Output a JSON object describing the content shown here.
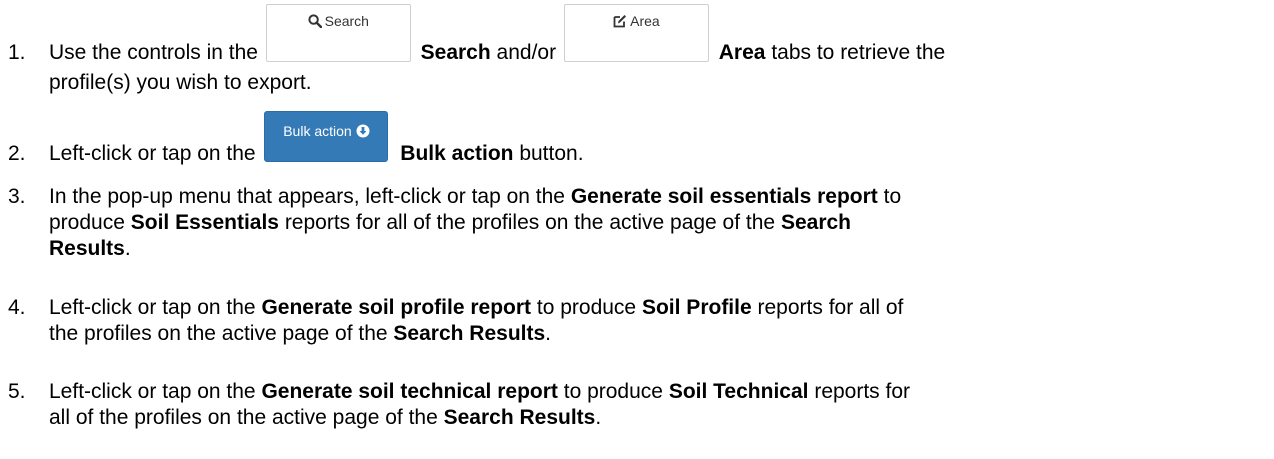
{
  "steps": [
    {
      "number": "1.",
      "text_a": "Use the controls in the",
      "search_tab_label": "Search",
      "search_bold": "Search",
      "text_b": "and/or",
      "area_tab_label": "Area",
      "area_bold": "Area",
      "text_c": "tabs to retrieve the",
      "text_d": "profile(s) you wish to export."
    },
    {
      "number": "2.",
      "text_a": "Left-click or tap on the",
      "button_label": "Bulk action",
      "bold": "Bulk action",
      "text_b": "button."
    },
    {
      "number": "3.",
      "text_a": "In the pop-up menu that appears, left-click or tap on the",
      "bold_a": "Generate soil essentials report",
      "text_b": "to",
      "text_c": "produce",
      "bold_b": "Soil Essentials",
      "text_d": "reports for all of the profiles on the active page of the",
      "bold_c": "Search",
      "bold_d": "Results",
      "text_e": "."
    },
    {
      "number": "4.",
      "text_a": "Left-click or tap on the",
      "bold_a": "Generate soil profile report",
      "text_b": "to produce",
      "bold_b": "Soil Profile",
      "text_c": "reports for all of",
      "text_d": "the profiles on the active page of the",
      "bold_c": "Search Results",
      "text_e": "."
    },
    {
      "number": "5.",
      "text_a": "Left-click or tap on the",
      "bold_a": "Generate soil technical report",
      "text_b": "to produce",
      "bold_b": "Soil Technical",
      "text_c": "reports for",
      "text_d": "all of the profiles on the active page of the",
      "bold_c": "Search Results",
      "text_e": "."
    }
  ],
  "icons": {
    "search": "magnifier-icon",
    "area": "edit-square-icon",
    "bulk": "circle-arrow-down-icon"
  },
  "colors": {
    "bulk_button_bg": "#337ab7",
    "tab_button_border": "#cfcfcf"
  }
}
